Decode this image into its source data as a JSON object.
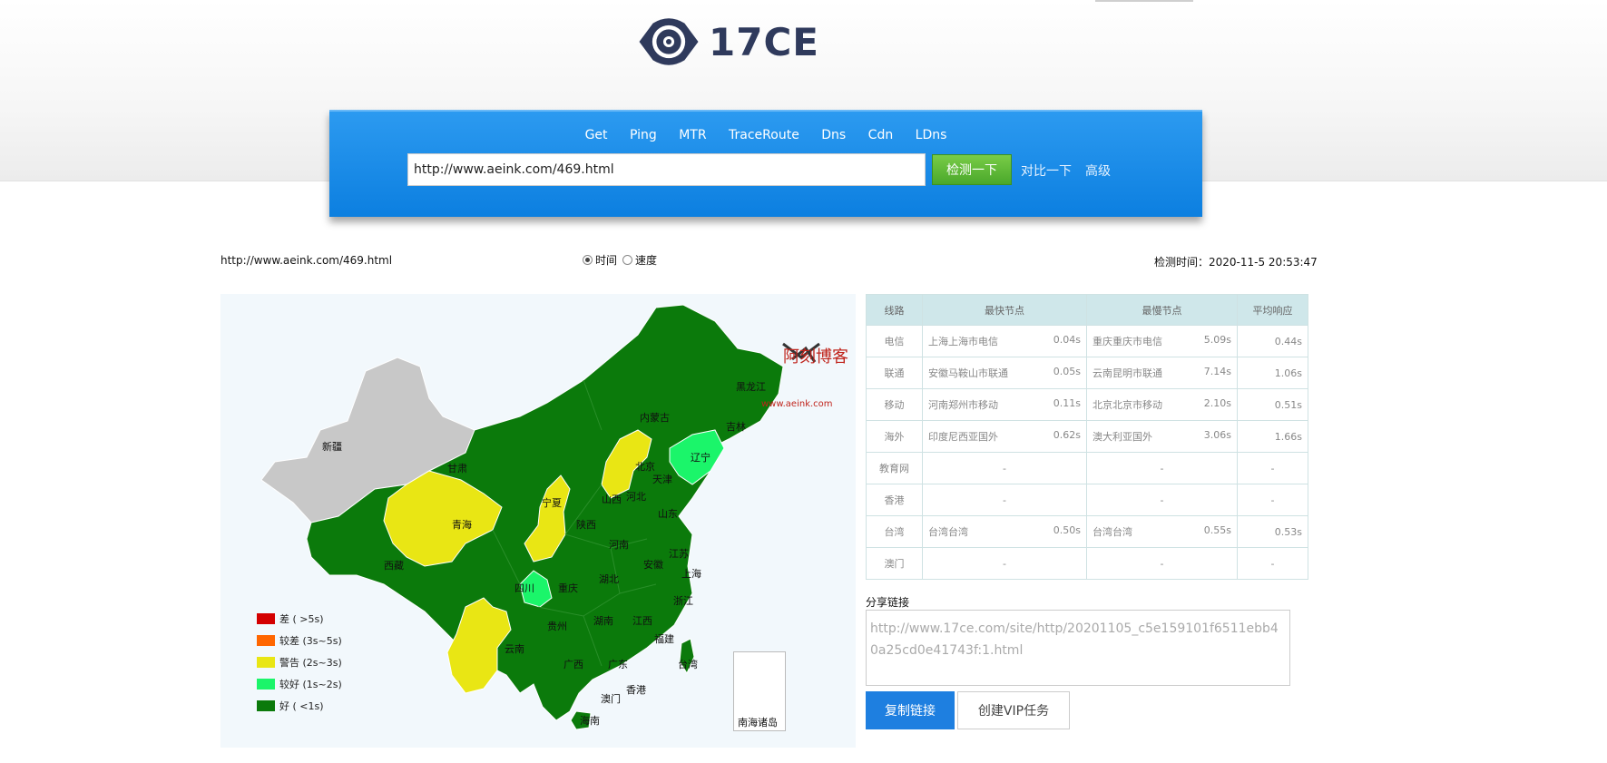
{
  "logo": {
    "text": "17CE"
  },
  "nav": {
    "tabs": [
      "Get",
      "Ping",
      "MTR",
      "TraceRoute",
      "Dns",
      "Cdn",
      "LDns"
    ]
  },
  "search": {
    "value": "http://www.aeink.com/469.html",
    "check_label": "检测一下",
    "compare_label": "对比一下",
    "advanced_label": "高级"
  },
  "result": {
    "url": "http://www.aeink.com/469.html",
    "radio_time": "时间",
    "radio_speed": "速度",
    "check_time": "检测时间：2020-11-5 20:53:47"
  },
  "map": {
    "provinces": [
      "新疆",
      "西藏",
      "青海",
      "甘肃",
      "内蒙古",
      "黑龙江",
      "吉林",
      "辽宁",
      "北京",
      "天津",
      "河北",
      "山西",
      "宁夏",
      "陕西",
      "山东",
      "河南",
      "江苏",
      "安徽",
      "上海",
      "四川",
      "重庆",
      "湖北",
      "浙江",
      "贵州",
      "湖南",
      "江西",
      "云南",
      "广西",
      "广东",
      "福建",
      "台湾",
      "香港",
      "澳门",
      "海南"
    ],
    "sea_label": "南海诸岛",
    "watermark": "阿刻博客",
    "watermark_sub": "www.aeink.com",
    "legend": [
      {
        "label": "差 ( >5s)",
        "color": "#d40000"
      },
      {
        "label": "较差 (3s~5s)",
        "color": "#ff6600"
      },
      {
        "label": "警告 (2s~3s)",
        "color": "#e9e614"
      },
      {
        "label": "较好 (1s~2s)",
        "color": "#1bf56a"
      },
      {
        "label": "好 ( <1s)",
        "color": "#0b7a0b"
      }
    ]
  },
  "table": {
    "headers": [
      "线路",
      "最快节点",
      "最慢节点",
      "平均响应"
    ],
    "rows": [
      {
        "line": "电信",
        "fast_node": "上海上海市电信",
        "fast_time": "0.04s",
        "slow_node": "重庆重庆市电信",
        "slow_time": "5.09s",
        "avg": "0.44s"
      },
      {
        "line": "联通",
        "fast_node": "安徽马鞍山市联通",
        "fast_time": "0.05s",
        "slow_node": "云南昆明市联通",
        "slow_time": "7.14s",
        "avg": "1.06s"
      },
      {
        "line": "移动",
        "fast_node": "河南郑州市移动",
        "fast_time": "0.11s",
        "slow_node": "北京北京市移动",
        "slow_time": "2.10s",
        "avg": "0.51s"
      },
      {
        "line": "海外",
        "fast_node": "印度尼西亚国外",
        "fast_time": "0.62s",
        "slow_node": "澳大利亚国外",
        "slow_time": "3.06s",
        "avg": "1.66s"
      },
      {
        "line": "教育网",
        "dash": "-"
      },
      {
        "line": "香港",
        "dash": "-"
      },
      {
        "line": "台湾",
        "fast_node": "台湾台湾",
        "fast_time": "0.50s",
        "slow_node": "台湾台湾",
        "slow_time": "0.55s",
        "avg": "0.53s"
      },
      {
        "line": "澳门",
        "dash": "-"
      }
    ]
  },
  "share": {
    "label": "分享链接",
    "url": "http://www.17ce.com/site/http/20201105_c5e159101f6511ebb40a25cd0e41743f:1.html",
    "copy_label": "复制链接",
    "vip_label": "创建VIP任务"
  }
}
